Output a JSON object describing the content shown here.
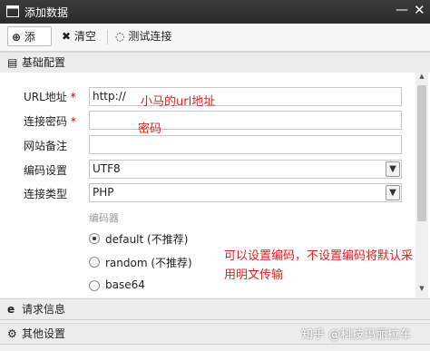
{
  "window": {
    "title": "添加数据",
    "minimize": "—",
    "close": "✕"
  },
  "toolbar": {
    "add_label": "添加",
    "clear_label": "清空",
    "test_label": "测试连接"
  },
  "sections": {
    "basic": "基础配置",
    "request": "请求信息",
    "other": "其他设置"
  },
  "form": {
    "url": {
      "label": "URL地址",
      "value": "http://"
    },
    "password": {
      "label": "连接密码",
      "value": ""
    },
    "remark": {
      "label": "网站备注",
      "value": ""
    },
    "encoding": {
      "label": "编码设置",
      "value": "UTF8"
    },
    "type": {
      "label": "连接类型",
      "value": "PHP"
    },
    "encoder": {
      "legend": "编码器",
      "options": [
        "default (不推荐)",
        "random (不推荐)",
        "base64"
      ],
      "selected": "default (不推荐)"
    }
  },
  "annotations": {
    "url_note": "小马的url地址",
    "password_note": "密码",
    "encoder_note_line1": "可以设置编码，不设置编码将默认采",
    "encoder_note_line2": "用明文传输"
  },
  "watermark": "知乎 @科技玛丽拉车"
}
